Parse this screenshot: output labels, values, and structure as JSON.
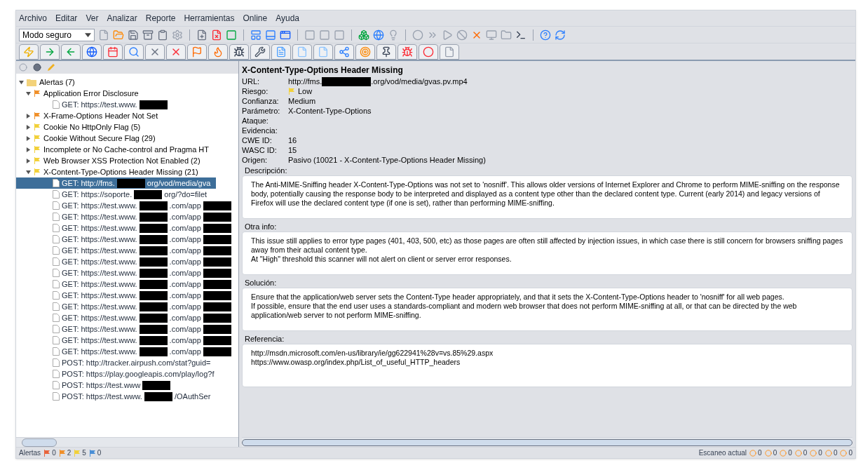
{
  "menu": [
    {
      "label": "Archivo"
    },
    {
      "label": "Editar"
    },
    {
      "label": "Ver"
    },
    {
      "label": "Analizar"
    },
    {
      "label": "Reporte"
    },
    {
      "label": "Herramientas"
    },
    {
      "label": "Online"
    },
    {
      "label": "Ayuda"
    }
  ],
  "mode_select": {
    "value": "Modo seguro"
  },
  "tree": {
    "label": "Alertas (7)",
    "expanded": true,
    "children": [
      {
        "label": "Application Error Disclosure",
        "color": "#f0902a",
        "expanded": true,
        "children": [
          {
            "selected": false,
            "segments": [
              {
                "kind": "text",
                "text": "GET: https://test.www."
              },
              {
                "kind": "redaction"
              }
            ]
          }
        ]
      },
      {
        "label": "X-Frame-Options Header Not Set",
        "color": "#f0902a",
        "expanded": false
      },
      {
        "label": "Cookie No HttpOnly Flag (5)",
        "color": "#f2d13a",
        "expanded": false
      },
      {
        "label": "Cookie Without Secure Flag (29)",
        "color": "#f2d13a",
        "expanded": false
      },
      {
        "label": "Incomplete or No Cache-control and Pragma HT",
        "color": "#f2d13a",
        "expanded": false
      },
      {
        "label": "Web Browser XSS Protection Not Enabled (2)",
        "color": "#f2d13a",
        "expanded": false
      },
      {
        "label": "X-Content-Type-Options Header Missing (21)",
        "color": "#f2d13a",
        "expanded": true,
        "children": [
          {
            "selected": true,
            "segments": [
              {
                "kind": "text",
                "text": "GET: http://fms."
              },
              {
                "kind": "redaction"
              },
              {
                "kind": "text",
                "text": "org/vod/media/gva"
              }
            ]
          },
          {
            "selected": false,
            "segments": [
              {
                "kind": "text",
                "text": "GET: https://soporte."
              },
              {
                "kind": "redaction"
              },
              {
                "kind": "text",
                "text": "org/?do=filet"
              }
            ]
          },
          {
            "selected": false,
            "segments": [
              {
                "kind": "text",
                "text": "GET: https://test.www."
              },
              {
                "kind": "redaction"
              },
              {
                "kind": "text",
                "text": ".com/app"
              },
              {
                "kind": "redaction"
              }
            ]
          },
          {
            "selected": false,
            "segments": [
              {
                "kind": "text",
                "text": "GET: https://test.www."
              },
              {
                "kind": "redaction"
              },
              {
                "kind": "text",
                "text": ".com/app"
              },
              {
                "kind": "redaction"
              }
            ]
          },
          {
            "selected": false,
            "segments": [
              {
                "kind": "text",
                "text": "GET: https://test.www."
              },
              {
                "kind": "redaction"
              },
              {
                "kind": "text",
                "text": ".com/app"
              },
              {
                "kind": "redaction"
              }
            ]
          },
          {
            "selected": false,
            "segments": [
              {
                "kind": "text",
                "text": "GET: https://test.www."
              },
              {
                "kind": "redaction"
              },
              {
                "kind": "text",
                "text": ".com/app"
              },
              {
                "kind": "redaction"
              }
            ]
          },
          {
            "selected": false,
            "segments": [
              {
                "kind": "text",
                "text": "GET: https://test.www."
              },
              {
                "kind": "redaction"
              },
              {
                "kind": "text",
                "text": ".com/app"
              },
              {
                "kind": "redaction"
              }
            ]
          },
          {
            "selected": false,
            "segments": [
              {
                "kind": "text",
                "text": "GET: https://test.www."
              },
              {
                "kind": "redaction"
              },
              {
                "kind": "text",
                "text": ".com/app"
              },
              {
                "kind": "redaction"
              }
            ]
          },
          {
            "selected": false,
            "segments": [
              {
                "kind": "text",
                "text": "GET: https://test.www."
              },
              {
                "kind": "redaction"
              },
              {
                "kind": "text",
                "text": ".com/app"
              },
              {
                "kind": "redaction"
              }
            ]
          },
          {
            "selected": false,
            "segments": [
              {
                "kind": "text",
                "text": "GET: https://test.www."
              },
              {
                "kind": "redaction"
              },
              {
                "kind": "text",
                "text": ".com/app"
              },
              {
                "kind": "redaction"
              }
            ]
          },
          {
            "selected": false,
            "segments": [
              {
                "kind": "text",
                "text": "GET: https://test.www."
              },
              {
                "kind": "redaction"
              },
              {
                "kind": "text",
                "text": ".com/app"
              },
              {
                "kind": "redaction"
              }
            ]
          },
          {
            "selected": false,
            "segments": [
              {
                "kind": "text",
                "text": "GET: https://test.www."
              },
              {
                "kind": "redaction"
              },
              {
                "kind": "text",
                "text": ".com/app"
              },
              {
                "kind": "redaction"
              }
            ]
          },
          {
            "selected": false,
            "segments": [
              {
                "kind": "text",
                "text": "GET: https://test.www."
              },
              {
                "kind": "redaction"
              },
              {
                "kind": "text",
                "text": ".com/app"
              },
              {
                "kind": "redaction"
              }
            ]
          },
          {
            "selected": false,
            "segments": [
              {
                "kind": "text",
                "text": "GET: https://test.www."
              },
              {
                "kind": "redaction"
              },
              {
                "kind": "text",
                "text": ".com/app"
              },
              {
                "kind": "redaction"
              }
            ]
          },
          {
            "selected": false,
            "segments": [
              {
                "kind": "text",
                "text": "GET: https://test.www."
              },
              {
                "kind": "redaction"
              },
              {
                "kind": "text",
                "text": ".com/app"
              },
              {
                "kind": "redaction"
              }
            ]
          },
          {
            "selected": false,
            "segments": [
              {
                "kind": "text",
                "text": "GET: https://test.www."
              },
              {
                "kind": "redaction"
              },
              {
                "kind": "text",
                "text": ".com/app"
              },
              {
                "kind": "redaction"
              }
            ]
          },
          {
            "selected": false,
            "segments": [
              {
                "kind": "text",
                "text": "POST: http://tracker.airpush.com/stat?guid="
              }
            ]
          },
          {
            "selected": false,
            "segments": [
              {
                "kind": "text",
                "text": "POST: https://play.googleapis.com/play/log?f"
              }
            ]
          },
          {
            "selected": false,
            "segments": [
              {
                "kind": "text",
                "text": "POST: https://test.www"
              },
              {
                "kind": "redaction"
              }
            ]
          },
          {
            "selected": false,
            "segments": [
              {
                "kind": "text",
                "text": "POST: https://test.www."
              },
              {
                "kind": "redaction"
              },
              {
                "kind": "text",
                "text": "/OAuthSer"
              }
            ]
          }
        ]
      }
    ]
  },
  "detail": {
    "title": "X-Content-Type-Options Header Missing",
    "fields": [
      {
        "label": "URL:",
        "kind": "url",
        "segments": [
          {
            "kind": "text",
            "text": "http://fms."
          },
          {
            "kind": "redaction"
          },
          {
            "kind": "text",
            "text": ".org/vod/media/gvas.pv.mp4"
          }
        ]
      },
      {
        "label": "Riesgo:",
        "kind": "risk",
        "value": "Low",
        "color": "#f2d13a"
      },
      {
        "label": "Confianza:",
        "kind": "text",
        "value": "Medium"
      },
      {
        "label": "Parámetro:",
        "kind": "text",
        "value": "X-Content-Type-Options"
      },
      {
        "label": "Ataque:",
        "kind": "empty"
      },
      {
        "label": "Evidencia:",
        "kind": "empty"
      },
      {
        "label": "CWE ID:",
        "kind": "text",
        "value": "16"
      },
      {
        "label": "WASC ID:",
        "kind": "text",
        "value": "15"
      },
      {
        "label": "Origen:",
        "kind": "text",
        "value": "Pasivo (10021 - X-Content-Type-Options Header Missing)"
      }
    ],
    "sections": [
      {
        "label": "Descripción:",
        "lines": [
          "The Anti-MIME-Sniffing header X-Content-Type-Options was not set to 'nosniff'. This allows older versions of Internet Explorer and Chrome to perform MIME-sniffing on the response body, potentially causing the response body to be interpreted and displayed as a content type other than the declared content type. Current (early 2014) and legacy versions of Firefox will use the declared content type (if one is set), rather than performing MIME-sniffing."
        ]
      },
      {
        "label": "Otra info:",
        "lines": [
          "This issue still applies to error type pages (401, 403, 500, etc) as those pages are often still affected by injection issues, in which case there is still concern for browsers sniffing pages away from their actual content type.",
          "At \"High\" threshold this scanner will not alert on client or server error responses."
        ]
      },
      {
        "label": "Solución:",
        "lines": [
          "Ensure that the application/web server sets the Content-Type header appropriately, and that it sets the X-Content-Type-Options header to 'nosniff' for all web pages.",
          "If possible, ensure that the end user uses a standards-compliant and modern web browser that does not perform MIME-sniffing at all, or that can be directed by the web application/web server to not perform MIME-sniffing."
        ]
      },
      {
        "label": "Referencia:",
        "lines": [
          "http://msdn.microsoft.com/en-us/library/ie/gg622941%28v=vs.85%29.aspx",
          "https://www.owasp.org/index.php/List_of_useful_HTTP_headers"
        ]
      }
    ]
  },
  "status_bar": {
    "alerts_label": "Alertas",
    "alert_counts": [
      {
        "value": "0",
        "color": "#e8643c"
      },
      {
        "value": "2",
        "color": "#f0902a"
      },
      {
        "value": "5",
        "color": "#f2d13a"
      },
      {
        "value": "0",
        "color": "#4a8fd6"
      }
    ],
    "scan_label": "Escaneo actual",
    "scan_counts": [
      "0",
      "0",
      "0",
      "0",
      "0",
      "0",
      "0"
    ]
  }
}
